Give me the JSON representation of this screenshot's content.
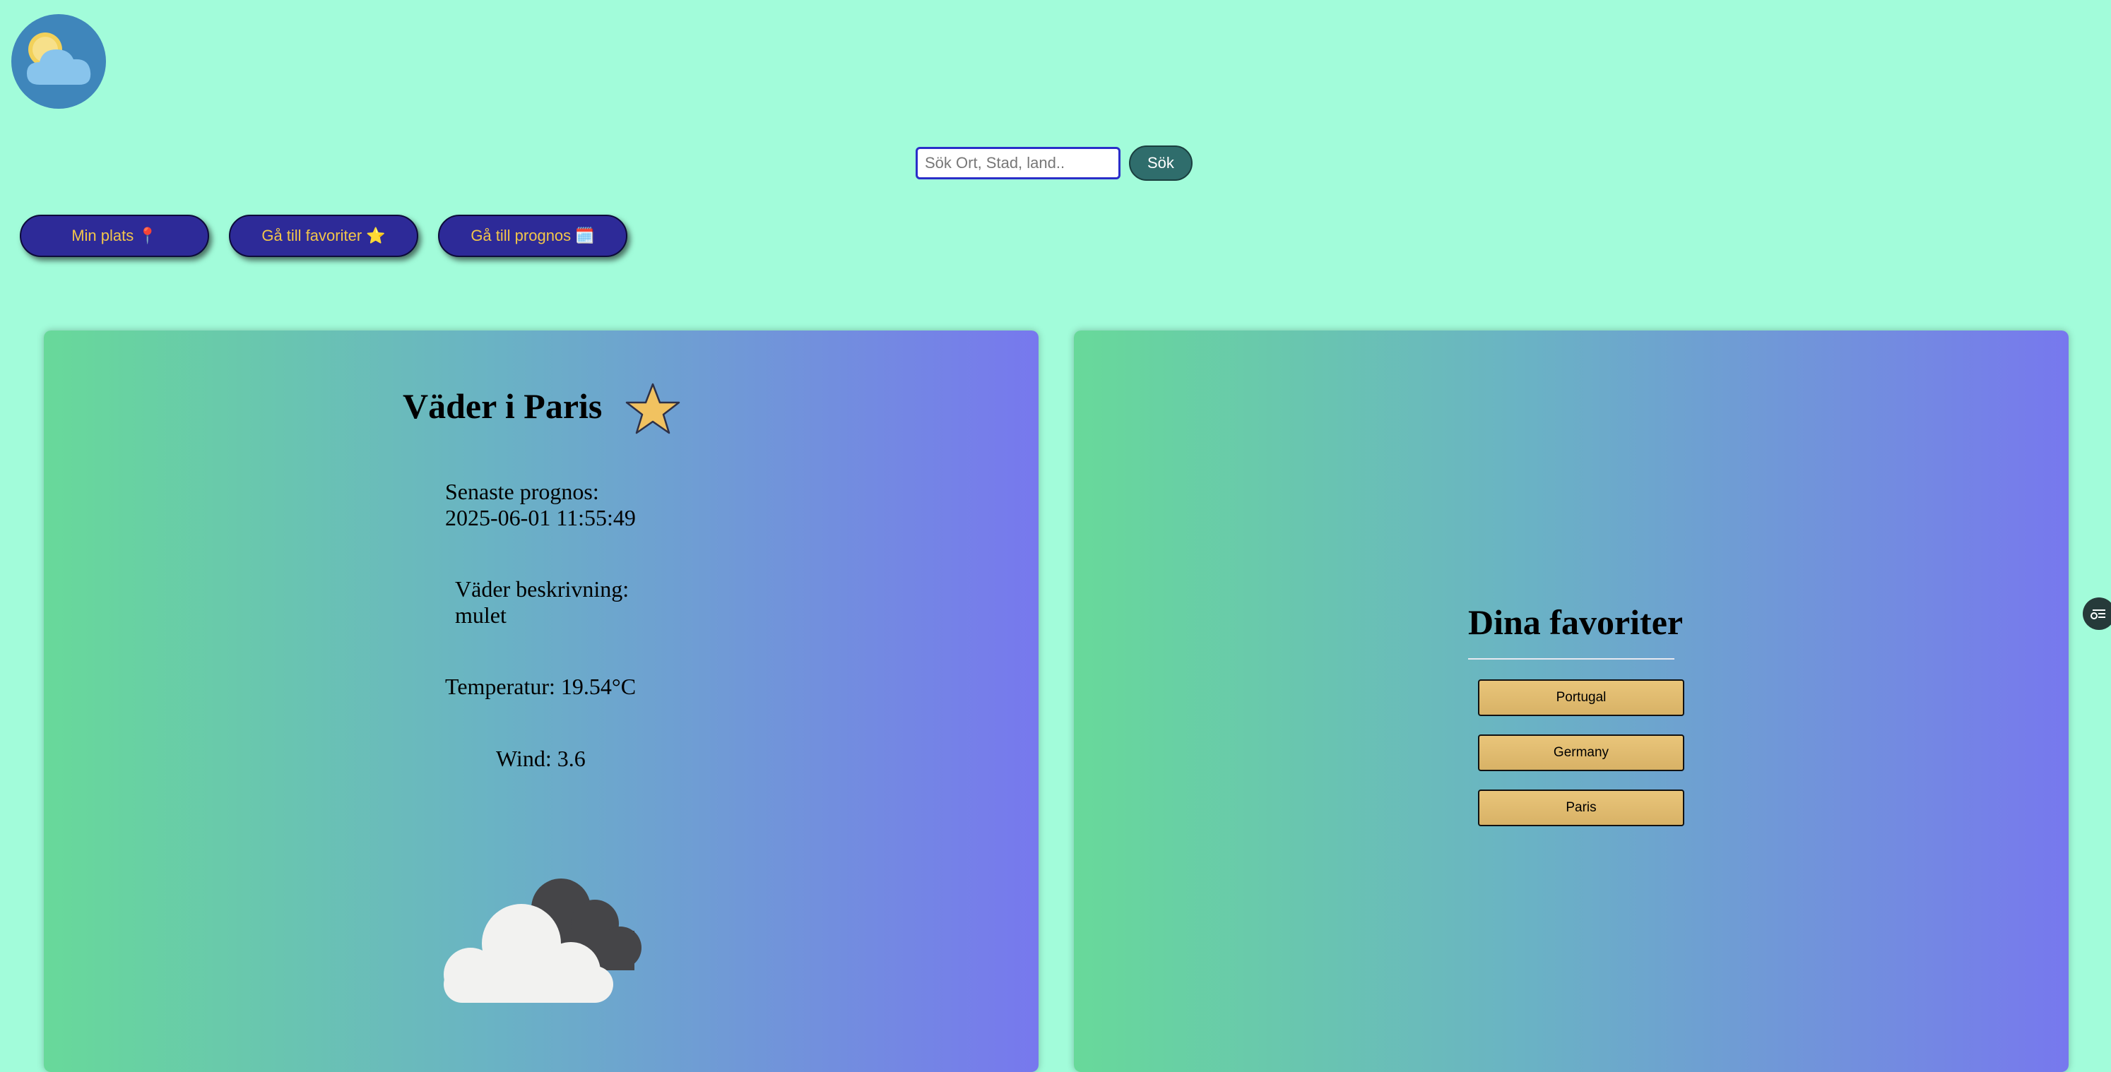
{
  "logo": {
    "icon": "sun-cloud-icon"
  },
  "search": {
    "placeholder": "Sök Ort, Stad, land..",
    "button_label": "Sök"
  },
  "nav": {
    "my_location": "Min plats 📍",
    "favorites": "Gå till favoriter ⭐",
    "forecast": "Gå till prognos 🗓️"
  },
  "weather": {
    "title": "Väder i Paris",
    "latest_label": "Senaste prognos:",
    "latest_value": "2025-06-01 11:55:49",
    "desc_label": "Väder beskrivning:",
    "desc_value": "mulet",
    "temperature": "Temperatur: 19.54°C",
    "wind": "Wind: 3.6",
    "icon": "cloudy-icon"
  },
  "favorites": {
    "title": "Dina favoriter",
    "items": [
      "Portugal",
      "Germany",
      "Paris"
    ]
  },
  "colors": {
    "background": "#a2fcda",
    "nav_button": "#2d2a98",
    "nav_text": "#f2c64a",
    "search_button": "#2f6d6c",
    "favorite_button": "#e0bb6f"
  }
}
